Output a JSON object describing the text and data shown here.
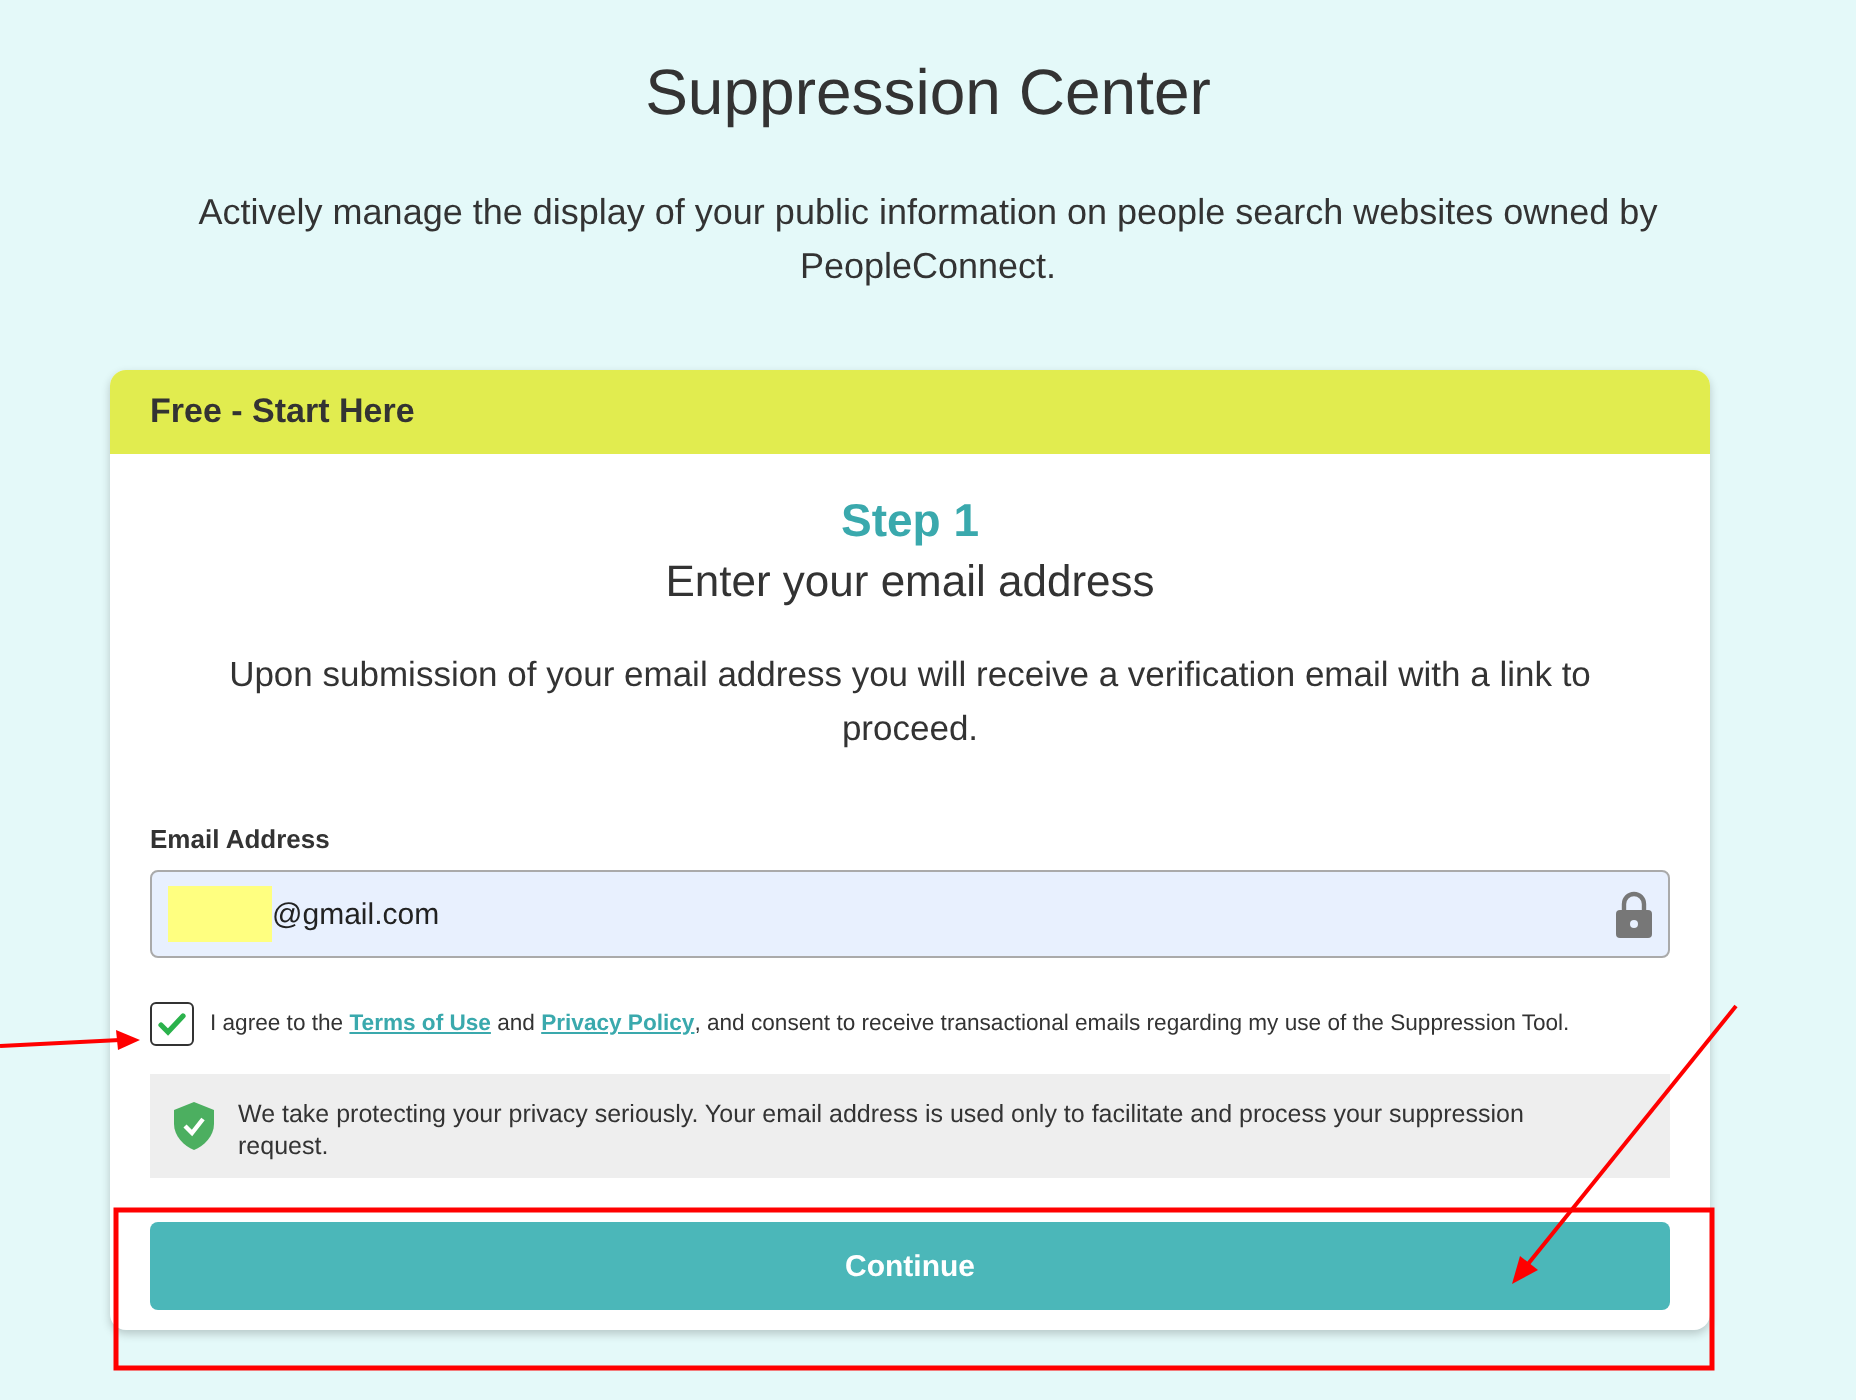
{
  "page": {
    "title": "Suppression Center",
    "subtitle": "Actively manage the display of your public information on people search websites owned by PeopleConnect."
  },
  "card": {
    "header": "Free - Start Here",
    "step": "Step 1",
    "heading": "Enter your email address",
    "description": "Upon submission of your email address you will receive a verification email with a link to proceed."
  },
  "email_field": {
    "label": "Email Address",
    "value": "@gmail.com",
    "redacted": true
  },
  "consent": {
    "checked": true,
    "parts": [
      {
        "kind": "text",
        "text": "I agree to the "
      },
      {
        "kind": "link",
        "text": "Terms of Use"
      },
      {
        "kind": "text",
        "text": " and "
      },
      {
        "kind": "link",
        "text": "Privacy Policy"
      },
      {
        "kind": "text",
        "text": ", and consent to receive transactional emails regarding my use of the Suppression Tool."
      }
    ]
  },
  "privacy_note": "We take protecting your privacy seriously. Your email address is used only to facilitate and process your suppression request.",
  "button": "Continue",
  "annotations": [
    {
      "kind": "checkbox-arrow"
    },
    {
      "kind": "button-arrow"
    },
    {
      "kind": "button-frame"
    }
  ]
}
